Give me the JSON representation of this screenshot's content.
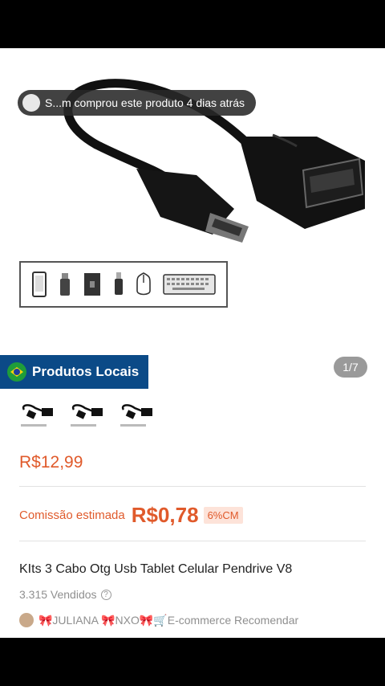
{
  "toast": {
    "text": "S...m comprou este produto 4 dias atrás"
  },
  "gallery": {
    "counter": "1/7"
  },
  "banner": {
    "label": "Produtos Locais"
  },
  "product": {
    "price": "R$12,99",
    "commission_label": "Comissão estimada",
    "commission_amount": "R$0,78",
    "commission_rate": "6%CM",
    "title": "KIts 3 Cabo Otg Usb Tablet Celular Pendrive V8",
    "sold": "3.315 Vendidos",
    "shop": "🎀JULIANA 🎀NXO🎀🛒E-commerce Recomendar"
  },
  "device_icons": [
    "phone-icon",
    "usb-stick-icon",
    "hard-drive-icon",
    "usb-plug-icon",
    "mouse-icon",
    "keyboard-icon"
  ],
  "colors": {
    "accent": "#e05a2b",
    "banner": "#0b4a87"
  }
}
